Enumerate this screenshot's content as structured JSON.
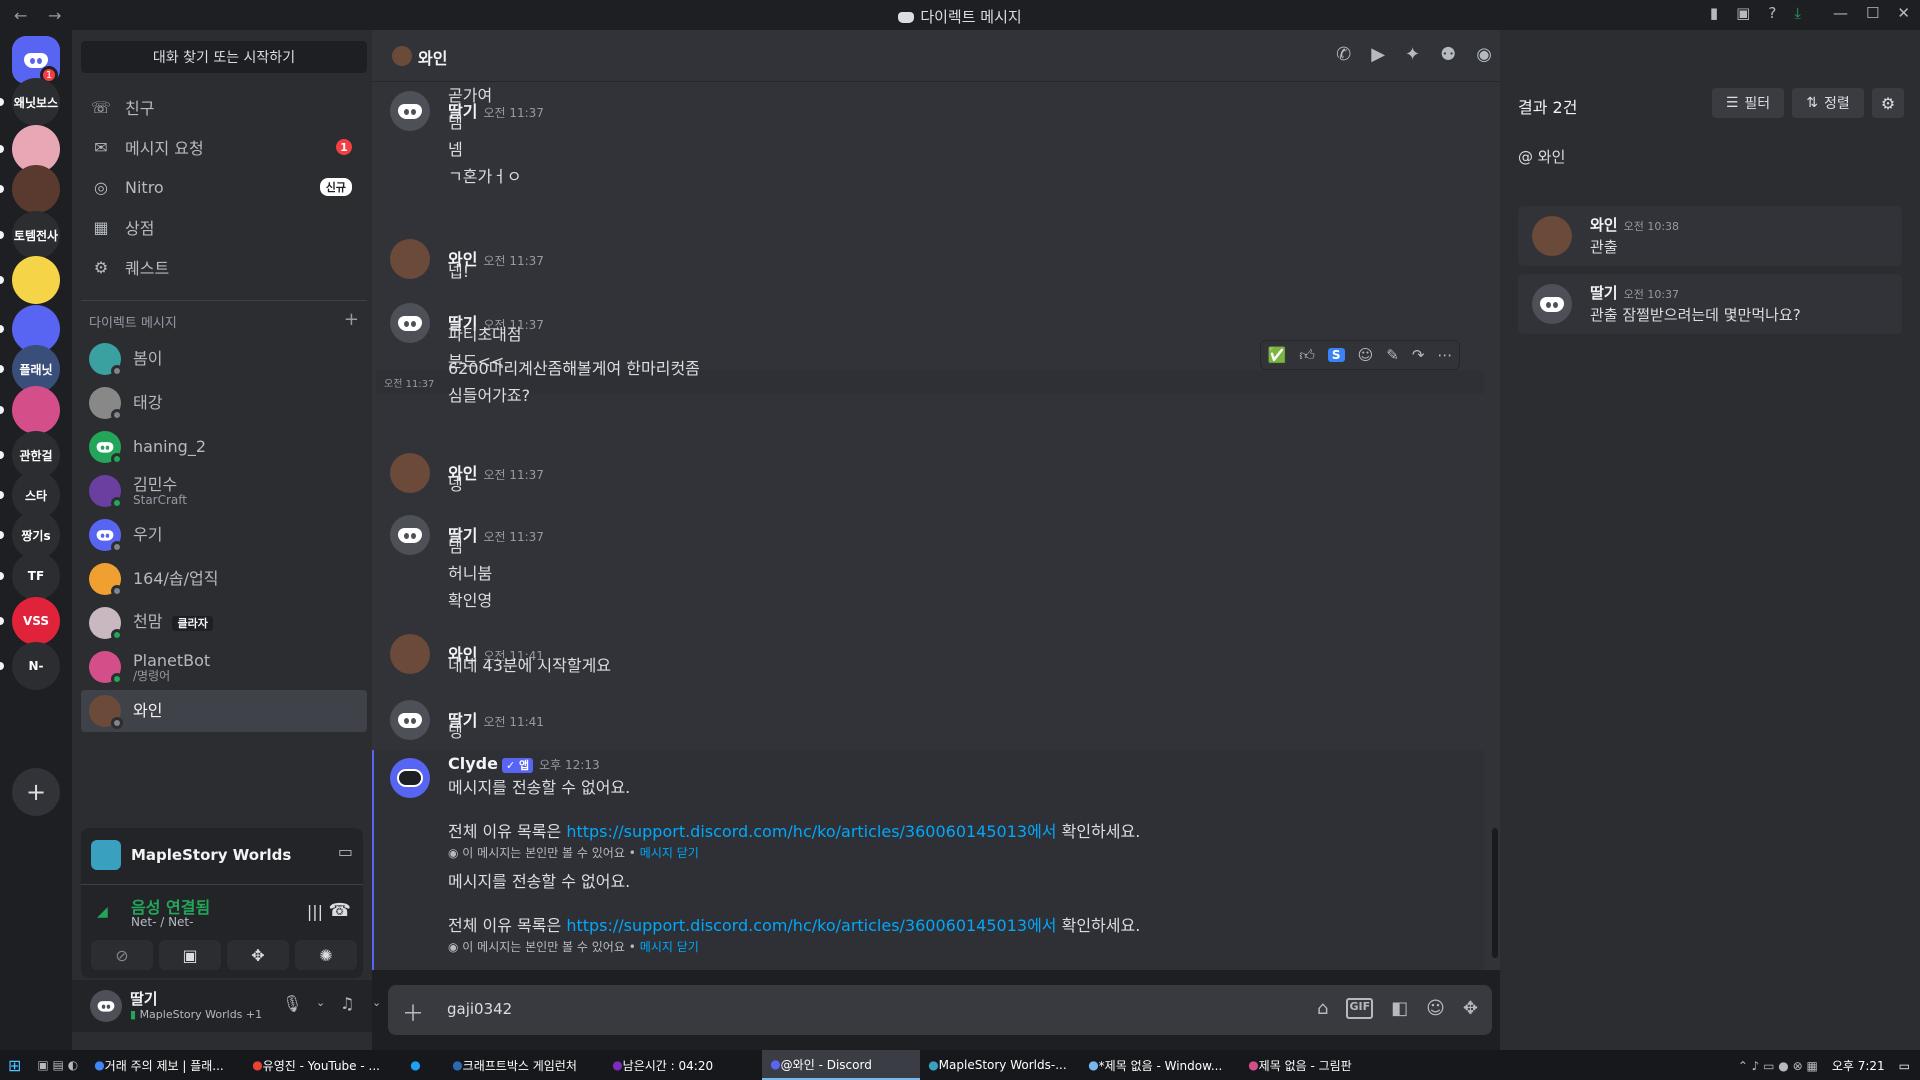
{
  "window": {
    "title": "다이렉트 메시지",
    "back": "←",
    "forward": "→"
  },
  "guilds": {
    "items": [
      {
        "label": "",
        "badge": "1",
        "color": "#5865f2"
      },
      {
        "label": "왜닛보스",
        "color": "#2b2d31"
      },
      {
        "label": "",
        "color": "#e8a7b5"
      },
      {
        "label": "",
        "color": "#5a3a2e"
      },
      {
        "label": "토템전사",
        "color": "#2b2d31"
      },
      {
        "label": "",
        "color": "#f5d547"
      },
      {
        "label": "",
        "color": "#5865f2"
      },
      {
        "label": "플래닛",
        "color": "#3a4e7a"
      },
      {
        "label": "",
        "color": "#d44f8a"
      },
      {
        "label": "관한걸",
        "color": "#2b2d31"
      },
      {
        "label": "스타",
        "color": "#2b2d31"
      },
      {
        "label": "짱기s",
        "color": "#2b2d31"
      },
      {
        "label": "TF",
        "color": "#2b2d31"
      },
      {
        "label": "VSS",
        "color": "#e0233a"
      },
      {
        "label": "N-",
        "color": "#2b2d31"
      }
    ]
  },
  "sidebar": {
    "search": "대화 찾기 또는 시작하기",
    "nav": [
      {
        "label": "친구",
        "icon": "friends-icon",
        "glyph": "☏"
      },
      {
        "label": "메시지 요청",
        "icon": "mail-icon",
        "glyph": "✉",
        "badge": "1"
      },
      {
        "label": "Nitro",
        "icon": "nitro-icon",
        "glyph": "◎",
        "tag": "신규"
      },
      {
        "label": "상점",
        "icon": "shop-icon",
        "glyph": "▦"
      },
      {
        "label": "퀘스트",
        "icon": "quest-icon",
        "glyph": "⚙"
      }
    ],
    "dm_header": "다이렉트 메시지",
    "dm_add": "+",
    "dms": [
      {
        "name": "봄이",
        "color": "#3aa0a0",
        "status": "off"
      },
      {
        "name": "태강",
        "color": "#888",
        "status": "off"
      },
      {
        "name": "haning_2",
        "color": "#23a55a",
        "status": "on"
      },
      {
        "name": "김민수",
        "sub": "StarCraft",
        "color": "#6b3fa0",
        "status": "on"
      },
      {
        "name": "우기",
        "color": "#5865f2",
        "status": "off"
      },
      {
        "name": "164/솝/업직",
        "color": "#f0a030",
        "status": "off"
      },
      {
        "name": "천맘",
        "tag": "클라자",
        "color": "#c9b8c0",
        "status": "on"
      },
      {
        "name": "PlanetBot",
        "sub": "/명령어",
        "color": "#d44f8a",
        "status": "on"
      },
      {
        "name": "와인",
        "color": "#6b4a3a",
        "status": "off",
        "active": true
      }
    ]
  },
  "voice": {
    "app": "MapleStory Worlds",
    "status": "음성 연결됨",
    "channel": "Net- / Net-"
  },
  "user": {
    "name": "딸기",
    "activity": "MapleStory Worlds +1"
  },
  "chat": {
    "title": "와인",
    "messages": [
      {
        "author": "딸기",
        "time": "오전 11:37",
        "av": "discord",
        "lines": [
          "넴",
          "넴",
          "ㄱ혼가ㅓㅇ",
          "곧가여"
        ]
      },
      {
        "author": "와인",
        "time": "오전 11:37",
        "av": "wine",
        "lines": [
          "넵!"
        ]
      },
      {
        "author": "딸기",
        "time": "오전 11:37",
        "av": "discord",
        "lines": [
          "파티초대점",
          "분드<<"
        ]
      },
      {
        "author": "",
        "time": "오전 11:37",
        "av": "none",
        "lines": [
          "6200마리계산좀해볼게여 한마리컷좀",
          "심들어가죠?"
        ]
      },
      {
        "author": "와인",
        "time": "오전 11:37",
        "av": "wine",
        "lines": [
          "넹"
        ]
      },
      {
        "author": "딸기",
        "time": "오전 11:37",
        "av": "discord",
        "lines": [
          "넴",
          "허니붐",
          "확인영"
        ]
      },
      {
        "author": "와인",
        "time": "오전 11:41",
        "av": "wine",
        "lines": [
          "네네 43분에 시작할게요"
        ]
      },
      {
        "author": "딸기",
        "time": "오전 11:41",
        "av": "discord",
        "lines": [
          "넹"
        ]
      }
    ],
    "clyde": {
      "author": "Clyde",
      "tag": "✓ 앱",
      "time": "오후 12:13",
      "line1": "메시지를 전송할 수 없어요.",
      "line2_pre": "전체 이유 목록은 ",
      "link": "https://support.discord.com/hc/ko/articles/360060145013에서",
      "line2_post": " 확인하세요.",
      "note": "이 메시지는 본인만 볼 수 있어요 •",
      "dismiss": "메시지 닫기"
    },
    "composer_value": "gaji0342",
    "hover_time": "오전 11:37"
  },
  "search": {
    "query": "관출",
    "results_label": "결과 2건",
    "filter": "필터",
    "sort": "정렬",
    "channel": "@ 와인",
    "results": [
      {
        "author": "와인",
        "time": "오전 10:38",
        "text": "관출",
        "av": "wine"
      },
      {
        "author": "딸기",
        "time": "오전 10:37",
        "text": "관출 잠쩔받으려는데 몇만먹나요?",
        "av": "discord"
      }
    ]
  },
  "taskbar": {
    "items": [
      "거래 주의 제보 | 플래...",
      "유영진 - YouTube - ...",
      "",
      "크래프트박스 게임런처",
      "남은시간 : 04:20",
      "@와인 - Discord",
      "MapleStory Worlds-...",
      "*제목 없음 - Window...",
      "제목 없음 - 그림판"
    ],
    "clock": "오후 7:21"
  }
}
